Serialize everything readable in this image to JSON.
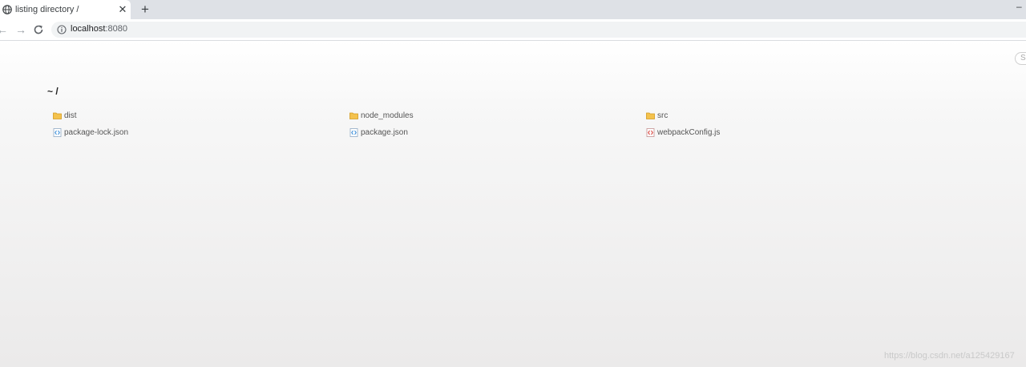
{
  "browser": {
    "tab": {
      "title": "listing directory /",
      "close": "✕"
    },
    "new_tab": "+",
    "window_minimize": "–",
    "url": {
      "host": "localhost",
      "port": ":8080"
    }
  },
  "page": {
    "search_placeholder": "S",
    "heading": "~ /",
    "files": [
      {
        "name": "dist",
        "type": "folder"
      },
      {
        "name": "node_modules",
        "type": "folder"
      },
      {
        "name": "src",
        "type": "folder"
      },
      {
        "name": "package-lock.json",
        "type": "json"
      },
      {
        "name": "package.json",
        "type": "json"
      },
      {
        "name": "webpackConfig.js",
        "type": "js"
      }
    ],
    "watermark": "https://blog.csdn.net/a125429167"
  },
  "colors": {
    "folder": "#f4c24d",
    "json": "#3a8ed9",
    "js": "#d9413a"
  }
}
